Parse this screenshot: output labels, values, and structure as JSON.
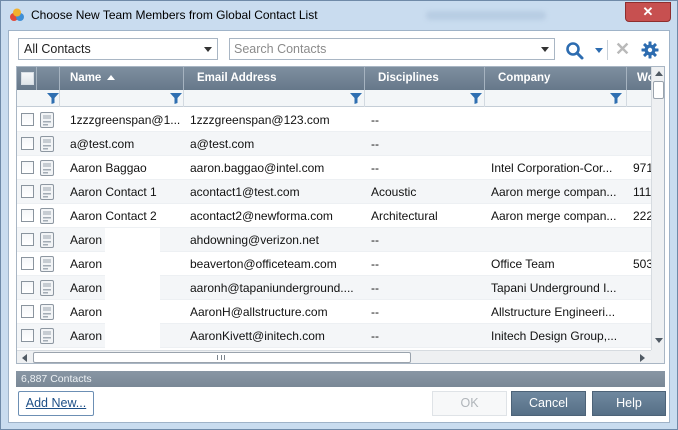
{
  "window": {
    "title": "Choose New Team Members from Global Contact List",
    "close_glyph": "✕"
  },
  "toolbar": {
    "contact_filter": "All Contacts",
    "search_placeholder": "Search Contacts",
    "icons": [
      "search-icon",
      "chevron-down-icon",
      "clear-x-icon",
      "gear-icon"
    ]
  },
  "grid": {
    "columns": [
      "Name",
      "Email Address",
      "Disciplines",
      "Company",
      "Wo"
    ],
    "sorted_column": "Name",
    "rows": [
      {
        "name": "1zzzgreenspan@1...",
        "email": "1zzzgreenspan@123.com",
        "discipline": "--",
        "company": "",
        "work": ""
      },
      {
        "name": "a@test.com",
        "email": "a@test.com",
        "discipline": "--",
        "company": "",
        "work": ""
      },
      {
        "name": "Aaron Baggao",
        "email": "aaron.baggao@intel.com",
        "discipline": "--",
        "company": "Intel Corporation-Cor...",
        "work": "971-"
      },
      {
        "name": "Aaron Contact 1",
        "email": "acontact1@test.com",
        "discipline": "Acoustic",
        "company": "Aaron merge compan...",
        "work": "111-"
      },
      {
        "name": "Aaron Contact 2",
        "email": "acontact2@newforma.com",
        "discipline": "Architectural",
        "company": "Aaron merge compan...",
        "work": "222-"
      },
      {
        "name": "Aaron",
        "email": "ahdowning@verizon.net",
        "discipline": "--",
        "company": "",
        "work": ""
      },
      {
        "name": "Aaron",
        "email": "beaverton@officeteam.com",
        "discipline": "--",
        "company": "Office Team",
        "work": "503-"
      },
      {
        "name": "Aaron",
        "email": "aaronh@tapaniunderground....",
        "discipline": "--",
        "company": "Tapani Underground I...",
        "work": ""
      },
      {
        "name": "Aaron",
        "email": "AaronH@allstructure.com",
        "discipline": "--",
        "company": "Allstructure Engineeri...",
        "work": ""
      },
      {
        "name": "Aaron",
        "email": "AaronKivett@initech.com",
        "discipline": "--",
        "company": "Initech Design Group,...",
        "work": ""
      }
    ]
  },
  "status": {
    "count_text": "6,887 Contacts"
  },
  "buttons": {
    "add_new": "Add New...",
    "ok": "OK",
    "cancel": "Cancel",
    "help": "Help"
  },
  "colors": {
    "header_bg": "#6f8193",
    "funnel": "#2f6fb1",
    "primary_button": "#5f778e",
    "title_bar": "#c9dcef"
  }
}
